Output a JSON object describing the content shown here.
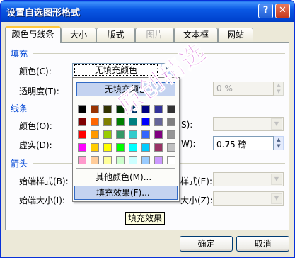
{
  "window": {
    "title": "设置自选图形格式",
    "help_icon": "question-icon",
    "close_icon": "close-icon"
  },
  "tabs": [
    {
      "label": "颜色与线条",
      "active": true
    },
    {
      "label": "大小"
    },
    {
      "label": "版式"
    },
    {
      "label": "图片",
      "disabled": true
    },
    {
      "label": "文本框"
    },
    {
      "label": "网站"
    }
  ],
  "fill": {
    "section": "填充",
    "color_label": "颜色(C):",
    "color_value": "无填充颜色",
    "transparency_label": "透明度(T):",
    "transparency_value": "0 %"
  },
  "line": {
    "section": "线条",
    "color_label": "颜色(O):",
    "style_label_partial": "S):",
    "dash_label": "虚实(D):",
    "weight_label_partial": "W):",
    "weight_value": "0.75 磅"
  },
  "arrows": {
    "section": "箭头",
    "begin_style_label": "始端样式(B):",
    "end_style_label_partial": "样式(E):",
    "begin_size_label": "始端大小(I):",
    "end_size_label_partial": "大小(Z):"
  },
  "popup": {
    "no_fill": "无填充颜色",
    "palette": [
      [
        "#000000",
        "#993300",
        "#333300",
        "#003300",
        "#003366",
        "#000080",
        "#333399",
        "#333333"
      ],
      [
        "#800000",
        "#ff6600",
        "#808000",
        "#008000",
        "#008080",
        "#0000ff",
        "#666699",
        "#808080"
      ],
      [
        "#ff0000",
        "#ff9900",
        "#99cc00",
        "#339966",
        "#33cccc",
        "#3366ff",
        "#800080",
        "#969696"
      ],
      [
        "#ff00ff",
        "#ffcc00",
        "#ffff00",
        "#00ff00",
        "#00ffff",
        "#00ccff",
        "#993366",
        "#c0c0c0"
      ],
      [
        "#ff99cc",
        "#ffcc99",
        "#ffff99",
        "#ccffcc",
        "#ccffff",
        "#99ccff",
        "#cc99ff",
        "#ffffff"
      ]
    ],
    "more_colors": "其他颜色(M)...",
    "fill_effects": "填充效果(F)..."
  },
  "tooltip": "填充效果",
  "buttons": {
    "ok": "确定",
    "cancel": "取消"
  },
  "watermark": "原创精选"
}
